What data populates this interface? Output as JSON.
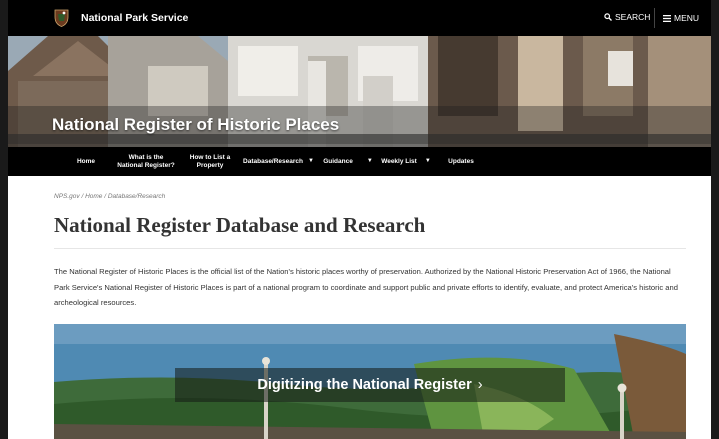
{
  "header": {
    "brand": "National Park Service",
    "search_label": "SEARCH",
    "menu_label": "MENU"
  },
  "hero": {
    "title": "National Register of Historic Places"
  },
  "nav": {
    "items": [
      {
        "label": "Home"
      },
      {
        "label": "What is the National Register?"
      },
      {
        "label": "How to List a Property"
      },
      {
        "label": "Database/Research"
      },
      {
        "label": "Guidance"
      },
      {
        "label": "Weekly List"
      },
      {
        "label": "Updates"
      }
    ],
    "caret": "▼"
  },
  "breadcrumb": {
    "items": [
      "NPS.gov",
      "Home",
      "Database/Research"
    ],
    "separator": " / "
  },
  "main": {
    "title": "National Register Database and Research",
    "intro": "The National Register of Historic Places is the official list of the Nation's historic places worthy of preservation. Authorized by the National Historic Preservation Act of 1966, the National Park Service's National Register of Historic Places is part of a national program to coordinate and support public and private efforts to identify, evaluate, and protect America's historic and archeological resources."
  },
  "feature": {
    "label": "Digitizing the National Register",
    "chevron": "›"
  },
  "colors": {
    "topbar": "#000000",
    "nav": "#000000",
    "text": "#333333"
  }
}
